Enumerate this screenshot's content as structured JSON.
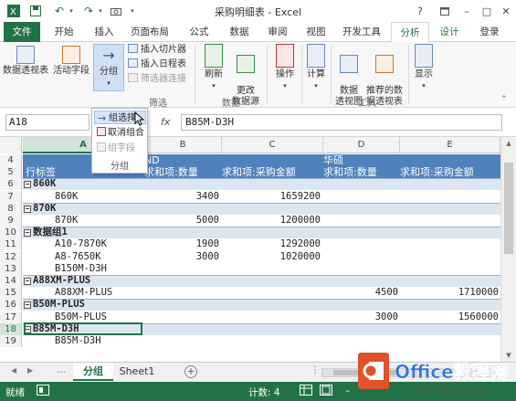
{
  "titlebar": {
    "title": "采购明细表 - Excel",
    "help": "?",
    "min": "–",
    "max": "□",
    "close": "✕"
  },
  "tabs": [
    "文件",
    "开始",
    "插入",
    "页面布局",
    "公式",
    "数据",
    "审阅",
    "视图",
    "开发工具",
    "分析",
    "设计",
    "登录"
  ],
  "ribbon": {
    "pivottable": "数据透视表",
    "active_field": "活动字段",
    "group": "分组",
    "insert_slicer": "插入切片器",
    "insert_timeline": "插入日程表",
    "filter_connections": "筛选器连接",
    "filter_group": "筛选",
    "refresh": "刷新",
    "change_source": "更改\n数据源",
    "data_group": "数据",
    "actions": "操作",
    "calculations": "计算",
    "pivotchart": "数据\n透视图",
    "recommended": "推荐的数\n据透视表",
    "tools_group": "工具",
    "show": "显示"
  },
  "menu": {
    "group_selection": "组选择",
    "ungroup": "取消组合",
    "group_field": "组字段",
    "label": "分组"
  },
  "formula": {
    "name_box": "A18",
    "fx": "fx",
    "value": "B85M-D3H"
  },
  "columns": [
    "A",
    "B",
    "C",
    "D",
    "E"
  ],
  "rows": [
    {
      "n": "4",
      "a": "",
      "b": "ND",
      "c": "",
      "d": "华硕",
      "e": ""
    },
    {
      "n": "5",
      "a": "行标签",
      "b": "求和项:数量",
      "c": "求和项:采购金额",
      "d": "求和项:数量",
      "e": "求和项:采购金额"
    },
    {
      "n": "6",
      "a": "860K",
      "b": "",
      "c": "",
      "d": "",
      "e": ""
    },
    {
      "n": "7",
      "a": "860K",
      "b": "3400",
      "c": "1659200",
      "d": "",
      "e": ""
    },
    {
      "n": "8",
      "a": "870K",
      "b": "",
      "c": "",
      "d": "",
      "e": ""
    },
    {
      "n": "9",
      "a": "870K",
      "b": "5000",
      "c": "1200000",
      "d": "",
      "e": ""
    },
    {
      "n": "10",
      "a": "数据组1",
      "b": "",
      "c": "",
      "d": "",
      "e": ""
    },
    {
      "n": "11",
      "a": "A10-7870K",
      "b": "1900",
      "c": "1292000",
      "d": "",
      "e": ""
    },
    {
      "n": "12",
      "a": "A8-7650K",
      "b": "3000",
      "c": "1020000",
      "d": "",
      "e": ""
    },
    {
      "n": "13",
      "a": "B150M-D3H",
      "b": "",
      "c": "",
      "d": "",
      "e": ""
    },
    {
      "n": "14",
      "a": "A88XM-PLUS",
      "b": "",
      "c": "",
      "d": "",
      "e": ""
    },
    {
      "n": "15",
      "a": "A88XM-PLUS",
      "b": "",
      "c": "",
      "d": "4500",
      "e": "1710000"
    },
    {
      "n": "16",
      "a": "B50M-PLUS",
      "b": "",
      "c": "",
      "d": "",
      "e": ""
    },
    {
      "n": "17",
      "a": "B50M-PLUS",
      "b": "",
      "c": "",
      "d": "3000",
      "e": "1560000"
    },
    {
      "n": "18",
      "a": "B85M-D3H",
      "b": "",
      "c": "",
      "d": "",
      "e": ""
    },
    {
      "n": "19",
      "a": "B85M-D3H",
      "b": "",
      "c": "",
      "d": "",
      "e": ""
    }
  ],
  "sheets": {
    "active": "分组",
    "other": "Sheet1",
    "add": "+"
  },
  "status": {
    "mode": "就绪",
    "count": "计数: 4",
    "zoom_minus": "–"
  },
  "watermark": {
    "text": "Office教程网",
    "url": "www.office26.com"
  },
  "colors": {
    "excel_green": "#217346",
    "header_blue": "#4f81bd",
    "band_blue": "#dce6f1"
  }
}
